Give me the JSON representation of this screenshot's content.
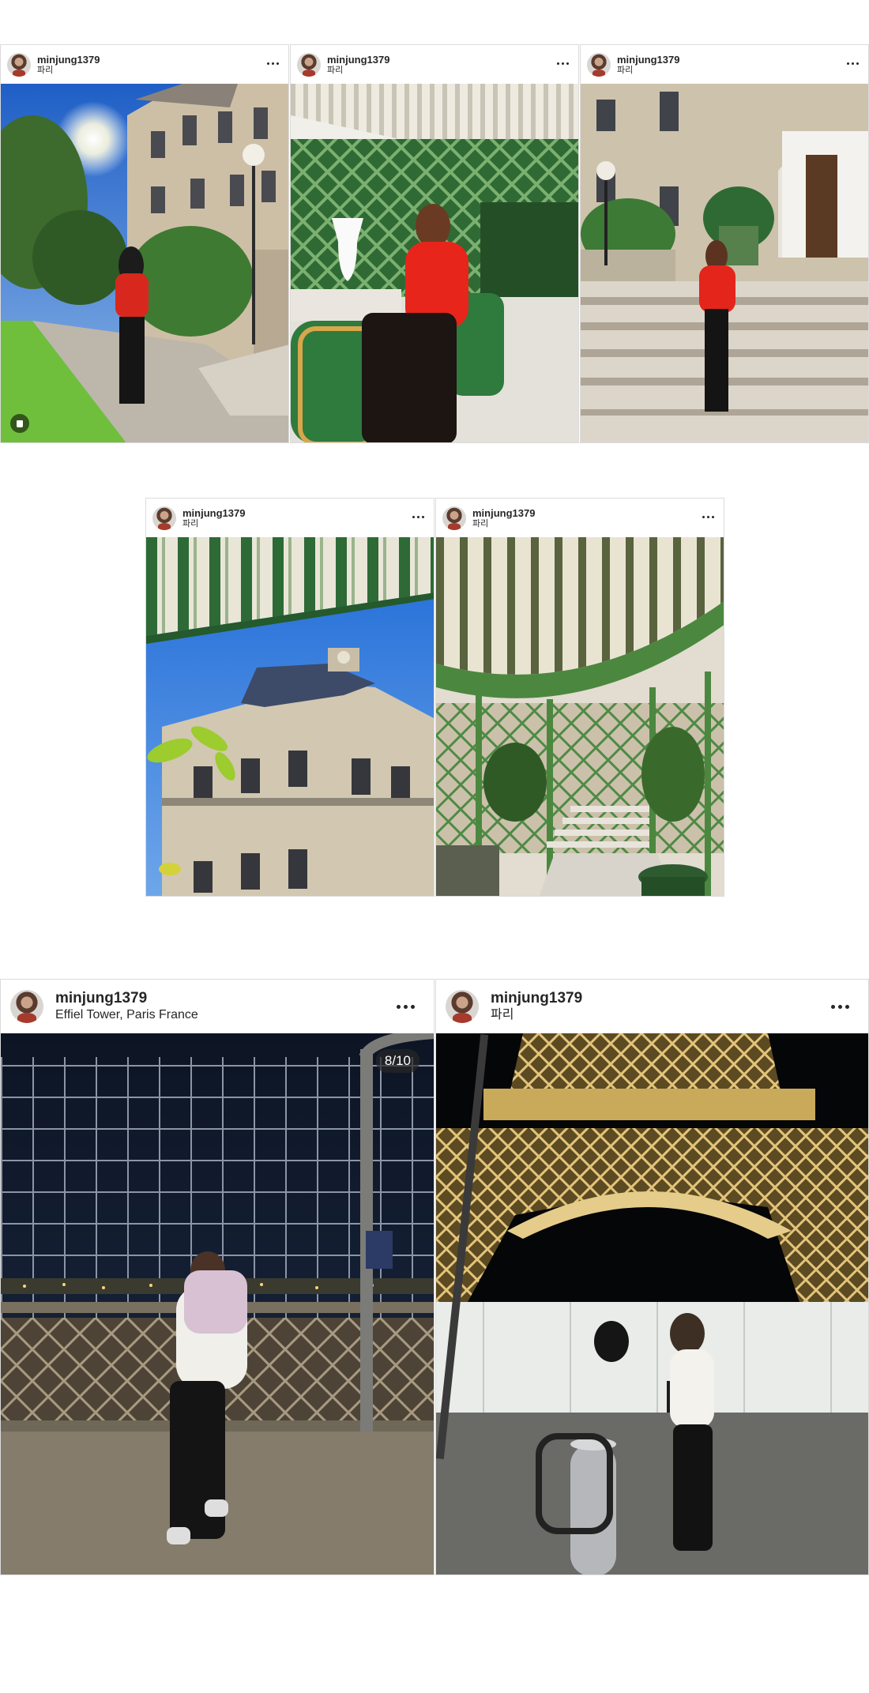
{
  "posts": [
    {
      "username": "minjung1379",
      "location": "파리"
    },
    {
      "username": "minjung1379",
      "location": "파리"
    },
    {
      "username": "minjung1379",
      "location": "파리"
    },
    {
      "username": "minjung1379",
      "location": "파리"
    },
    {
      "username": "minjung1379",
      "location": "파리"
    },
    {
      "username": "minjung1379",
      "location": "Effiel Tower, Paris France",
      "counter": "8/10"
    },
    {
      "username": "minjung1379",
      "location": "파리"
    }
  ],
  "icons": {
    "more": "more-horizontal-icon",
    "avatar": "profile-avatar",
    "carousel_badge": "user-tag-icon"
  }
}
